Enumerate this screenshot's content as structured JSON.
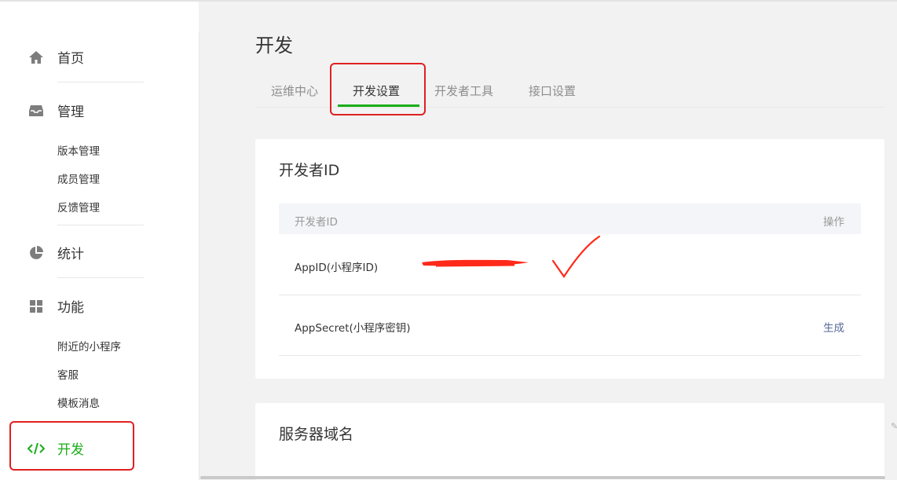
{
  "sidebar": {
    "home_label": "首页",
    "manage_label": "管理",
    "manage_items": [
      "版本管理",
      "成员管理",
      "反馈管理"
    ],
    "stats_label": "统计",
    "features_label": "功能",
    "features_items": [
      "附近的小程序",
      "客服",
      "模板消息"
    ],
    "dev_label": "开发"
  },
  "main": {
    "title": "开发",
    "tabs": [
      "运维中心",
      "开发设置",
      "开发者工具",
      "接口设置"
    ],
    "active_tab": "开发设置"
  },
  "developer_card": {
    "title": "开发者ID",
    "col_id": "开发者ID",
    "col_action": "操作",
    "rows": [
      {
        "label": "AppID(小程序ID)",
        "action": ""
      },
      {
        "label": "AppSecret(小程序密钥)",
        "action": "生成"
      }
    ]
  },
  "server_card": {
    "title": "服务器域名"
  },
  "colors": {
    "accent_green": "#1aad19",
    "highlight_red": "#e02020",
    "link_blue": "#576b95"
  }
}
